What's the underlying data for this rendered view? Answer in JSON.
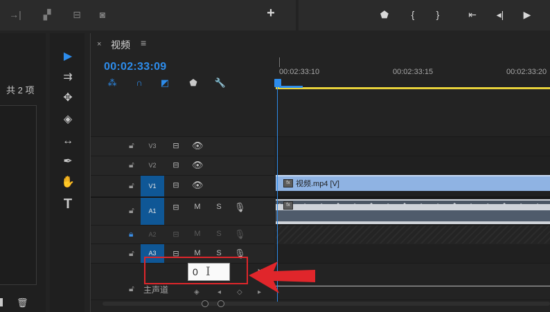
{
  "top_toolbar": {
    "left_icons": [
      "insert-arrow-icon",
      "link-clips-icon",
      "export-frame-icon",
      "camera-icon"
    ],
    "add_button": "+",
    "right_icons": [
      "marker-icon",
      "in-point-icon",
      "out-point-icon",
      "go-to-in-icon",
      "step-back-icon",
      "play-icon"
    ],
    "right_glyphs": [
      "⬟",
      "{",
      "}",
      "⇤",
      "◂|",
      "▶"
    ]
  },
  "project_panel": {
    "item_count": "共 2 项"
  },
  "tools": [
    {
      "name": "selection-tool",
      "glyph": "▶"
    },
    {
      "name": "track-select-tool",
      "glyph": "⇉"
    },
    {
      "name": "ripple-edit-tool",
      "glyph": "✥"
    },
    {
      "name": "razor-tool",
      "glyph": "◈"
    },
    {
      "name": "slip-tool",
      "glyph": "↔"
    },
    {
      "name": "pen-tool",
      "glyph": "✒"
    },
    {
      "name": "hand-tool",
      "glyph": "✋"
    },
    {
      "name": "type-tool",
      "glyph": "T"
    }
  ],
  "sequence": {
    "close_glyph": "×",
    "title": "视频",
    "menu_glyph": "≡",
    "timecode": "00:02:33:09",
    "ruler_labels": [
      "00:02:33:10",
      "00:02:33:15",
      "00:02:33:20"
    ]
  },
  "tracks": {
    "video": [
      {
        "name": "V3",
        "targeted": false
      },
      {
        "name": "V2",
        "targeted": false
      },
      {
        "name": "V1",
        "targeted": true
      }
    ],
    "audio": [
      {
        "name": "A1",
        "targeted": true,
        "locked": false
      },
      {
        "name": "A2",
        "targeted": false,
        "locked": true
      },
      {
        "name": "A3",
        "targeted": true,
        "locked": false
      }
    ],
    "mute_label": "M",
    "solo_label": "S",
    "master_label": "主声道"
  },
  "clips": {
    "video_label": "视频.mp4 [V]",
    "fx_label": "fx"
  },
  "master_volume_input": {
    "value": "0"
  },
  "colors": {
    "accent": "#2d8ceb",
    "annotation": "#e0262b",
    "work_area": "#e8d23b",
    "video_clip": "#8fb3e3"
  }
}
